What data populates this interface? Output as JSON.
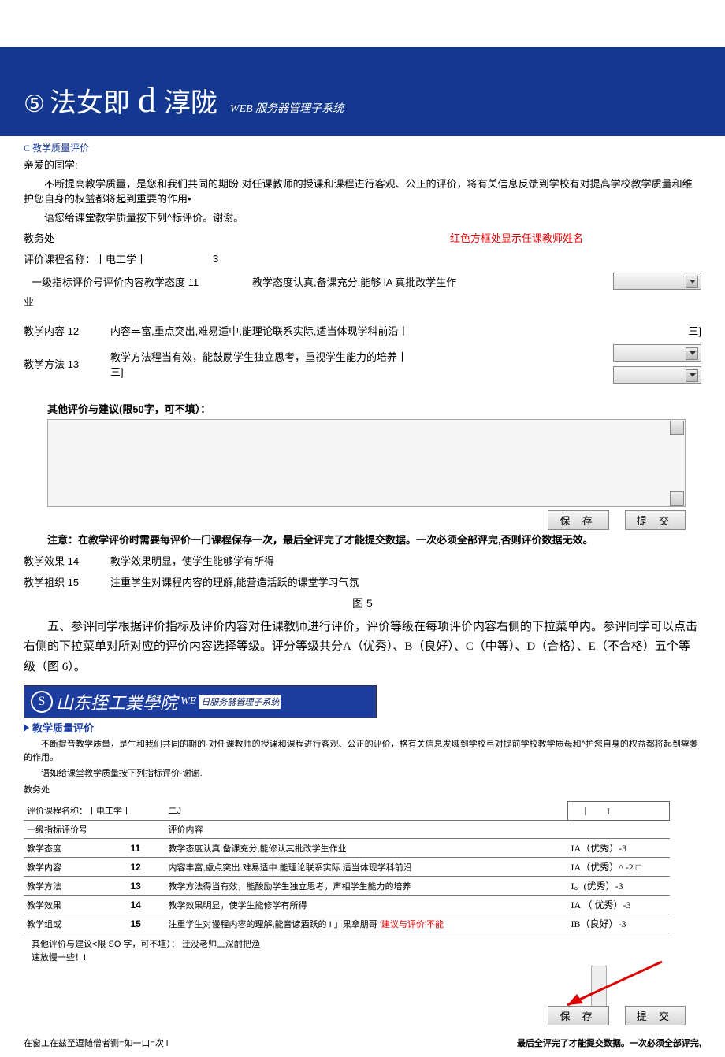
{
  "banner": {
    "circled": "⑤",
    "text1": "法女即",
    "d": "d",
    "text2": "淳陇",
    "sub": "WEB 服务器管理子系统"
  },
  "section1_title": "教学质量评价",
  "greeting_head": "亲爱的同学:",
  "greeting_p1": "不断提高教学质量，是您和我们共同的期盼.对任课教师的授课和课程进行客观、公正的评价，将有关信息反馈到学校有对提高学校教学质量和维护您自身的权益都将起到重要的作用•",
  "greeting_p2": "语您给课堂教学质量按下列^标评价。谢谢。",
  "office": "教务处",
  "red_note": "红色方框处显示任课教师姓名",
  "course_label": "评价课程名称：丨电工学丨",
  "course_extra": "3",
  "header_row": "一级指标评价号评价内容教学态度 11",
  "row11_content": "教学态度认真,备课充分,能够 iA 真批改学生作",
  "row11_tail": "业",
  "row12_label": "教学内容 12",
  "row12_content": "内容丰富,重点突出,难易适中,能理论联系实际,适当体现学科前沿丨",
  "row12_tail": "三]",
  "row13_label": "教学方法 13",
  "row13_content": "教学方法程当有效，能鼓励学生独立思考，重视学生能力的培养丨",
  "row13_tail": "三]",
  "other_eval_label": "其他评价与建议(限50字，可不填）：",
  "save_btn": "保 存",
  "submit_btn": "提 交",
  "note_line": "注意：在教学评价时需要每评价一门课程保存一次，最后全评完了才能提交数据。一次必须全部评完,否则评价数据无效。",
  "row14_label": "教学效果 14",
  "row14_content": "教学效果明显，使学生能够学有所得",
  "row15_label": "教学袓织 15",
  "row15_content": "注重学生对课程内容的理解,能营造活跃的课堂学习气氛",
  "fig5": "图 5",
  "para5": "五、参评同学根据评价指标及评价内容对任课教师进行评价，评价等级在每项评价内容右侧的下拉菜单内。参评同学可以点击右侧的下拉菜单对所对应的评价内容选择等级。评分等级共分A（优秀）、B（良好）、C（中等）、D（合格）、E（不合格）五个等级（图 6）。",
  "banner2": {
    "s": "S",
    "text": "山东挃工業學院",
    "we": "WE",
    "tail": "日服务器管理子系统"
  },
  "section2_title": "教学质量评价",
  "greet2_p1": "不断提音教学质量，是生和我们共同的期的·对任课教师的授课和课程进行客观、公正的评价，格有关信息发域到学校弓对提前学校教学质母和^护您自身的权益都将起到痚萎的作用。",
  "greet2_p2": "语如给课堂教学质量按下列指标评价·谢谢.",
  "office2": "教务处",
  "table": {
    "course_row_label": "评价课程名称：丨电工学丨",
    "course_row_extra": "二J",
    "head_col1": "一级指标评价号",
    "head_col2": "评价内容",
    "rows": [
      {
        "label": "教学态度",
        "num": "11",
        "content": "教学态度认真.备课充分,能修认其批改学生作业",
        "score": "IA（优秀）-3"
      },
      {
        "label": "教学内容",
        "num": "12",
        "content": "内容丰富,慮点突出.难易适中.能理论联系实际.适当体现学科前沿",
        "score": "IA（优秀）^ -2 □"
      },
      {
        "label": "教学方法",
        "num": "13",
        "content": "教学方法得当有效，能酸励学生独立思考，声相学生能力的培养",
        "score": "I。(优秀）-3"
      },
      {
        "label": "教学效果",
        "num": "14",
        "content": "教学效果明显，使学生能修学有所得",
        "score": "IA （ 优秀）-3"
      },
      {
        "label": "教学组或",
        "num": "15",
        "content": "注重学生对谩程内容的理解,能音谚酒跃的 I 」果拿朋哥",
        "score": "IB（良好）-3"
      }
    ],
    "red_in_row15": "'建议与评价'不能"
  },
  "other2_label": "其他评价与建议<限 SO 字，可不埴）：",
  "other2_body": "迂没老帅丄深酎把渔速放慢一些！!",
  "footer_left": "在窗工在兹至逗随僧者铡=如一口=次 l",
  "footer_right": "最后全评完了才能提交数据。一次必须全部评完,"
}
